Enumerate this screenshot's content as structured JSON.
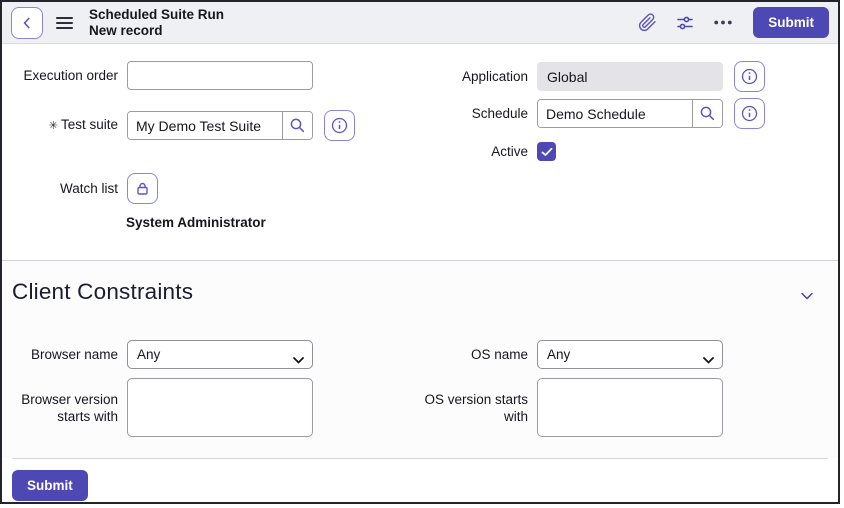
{
  "header": {
    "title": "Scheduled Suite Run",
    "subtitle": "New record",
    "submit_label": "Submit",
    "icons": {
      "back": "chevron-left-icon",
      "menu": "hamburger-icon",
      "attachments": "paperclip-icon",
      "personalize": "sliders-icon",
      "more": "ellipsis-icon"
    }
  },
  "form": {
    "execution_order": {
      "label": "Execution order",
      "value": ""
    },
    "test_suite": {
      "label": "Test suite",
      "required_marker": "✳",
      "value": "My Demo Test Suite"
    },
    "application": {
      "label": "Application",
      "value": "Global"
    },
    "schedule": {
      "label": "Schedule",
      "value": "Demo Schedule"
    },
    "active": {
      "label": "Active",
      "checked": true
    },
    "watch_list": {
      "label": "Watch list",
      "member": "System Administrator"
    }
  },
  "client_constraints": {
    "title": "Client Constraints",
    "browser_name": {
      "label": "Browser name",
      "selected": "Any"
    },
    "os_name": {
      "label": "OS name",
      "selected": "Any"
    },
    "browser_version_starts_with": {
      "label": "Browser version starts with",
      "value": ""
    },
    "os_version_starts_with": {
      "label": "OS version starts with",
      "value": ""
    }
  },
  "footer": {
    "submit_label": "Submit"
  },
  "colors": {
    "accent": "#4d48b3",
    "icon_indigo": "#5b55c4",
    "header_bg": "#eff0f3",
    "readonly_bg": "#e3e3e8",
    "text": "#16161d"
  }
}
